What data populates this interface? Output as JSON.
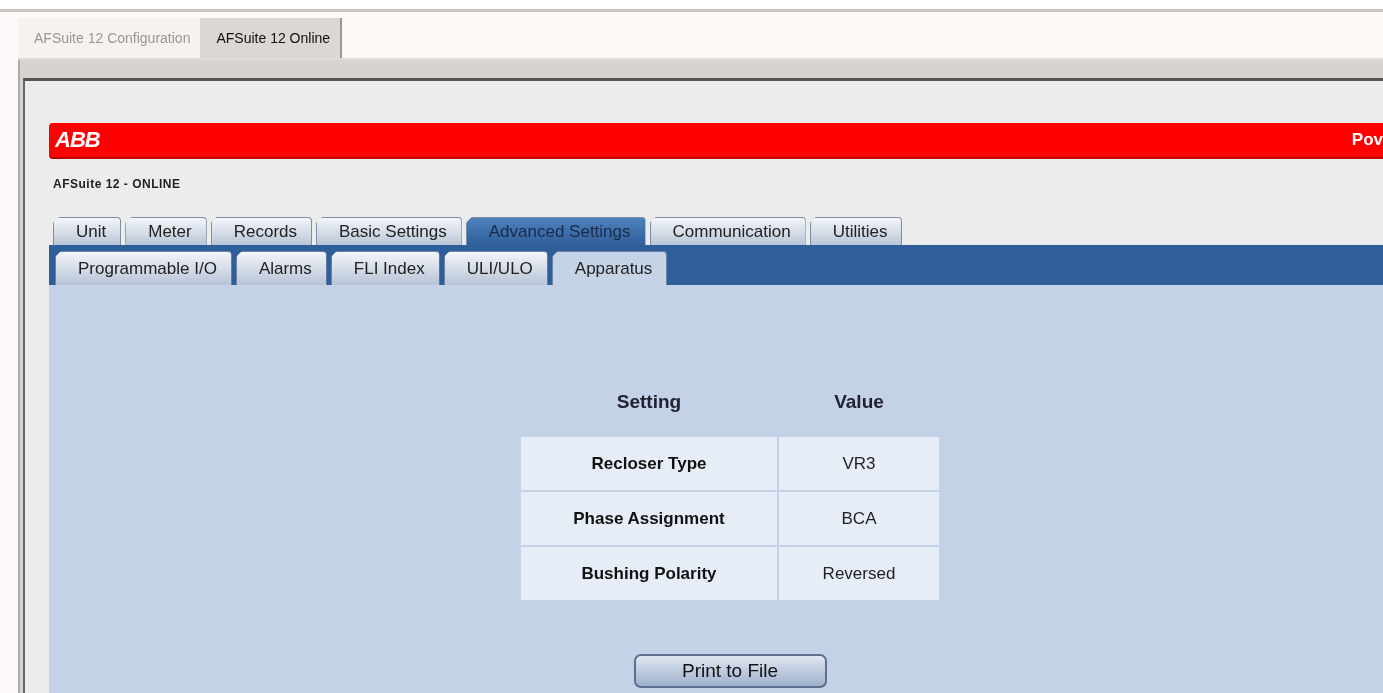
{
  "app_tabs": [
    {
      "label": "AFSuite 12 Configuration",
      "selected": false
    },
    {
      "label": "AFSuite 12 Online",
      "selected": true
    }
  ],
  "banner": {
    "logo": "ABB",
    "tagline": "Pov"
  },
  "subtitle": "AFSuite 12 - ONLINE",
  "tabs": [
    {
      "label": "Unit",
      "selected": false
    },
    {
      "label": "Meter",
      "selected": false
    },
    {
      "label": "Records",
      "selected": false
    },
    {
      "label": "Basic Settings",
      "selected": false
    },
    {
      "label": "Advanced Settings",
      "selected": true
    },
    {
      "label": "Communication",
      "selected": false
    },
    {
      "label": "Utilities",
      "selected": false
    }
  ],
  "subtabs": [
    {
      "label": "Programmable I/O",
      "selected": false
    },
    {
      "label": "Alarms",
      "selected": false
    },
    {
      "label": "FLI Index",
      "selected": false
    },
    {
      "label": "ULI/ULO",
      "selected": false
    },
    {
      "label": "Apparatus",
      "selected": true
    }
  ],
  "table": {
    "columns": [
      "Setting",
      "Value"
    ],
    "rows": [
      [
        "Recloser Type",
        "VR3"
      ],
      [
        "Phase Assignment",
        "BCA"
      ],
      [
        "Bushing Polarity",
        "Reversed"
      ]
    ]
  },
  "button": "Print to File"
}
